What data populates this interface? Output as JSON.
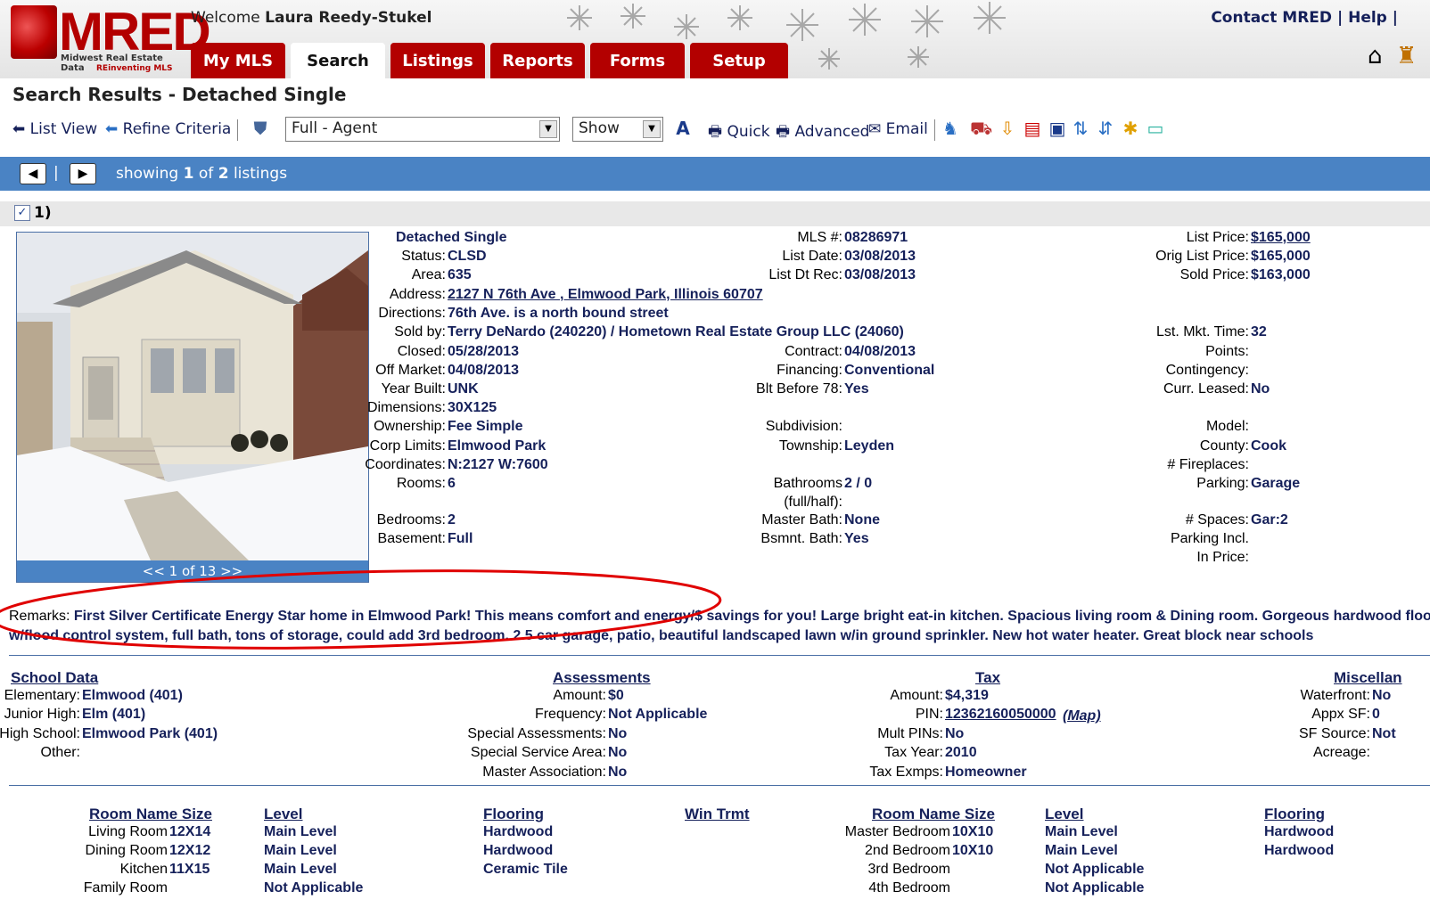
{
  "header": {
    "logo_text": "MRED",
    "logo_sub1": "Midwest Real Estate Data",
    "logo_sub2": "REinventing MLS",
    "welcome_prefix": "Welcome",
    "user_name": "Laura Reedy-Stukel",
    "contact_link": "Contact MRED",
    "help_link": "Help",
    "tabs": [
      "My MLS",
      "Search",
      "Listings",
      "Reports",
      "Forms",
      "Setup"
    ]
  },
  "page_title": "Search Results - Detached Single",
  "toolbar": {
    "list_view": "List View",
    "refine": "Refine Criteria",
    "report_format": "Full - Agent",
    "show": "Show",
    "quick": "Quick",
    "advanced": "Advanced",
    "email": "Email"
  },
  "nav": {
    "showing_prefix": "showing",
    "current": "1",
    "of": "of",
    "total": "2",
    "suffix": "listings"
  },
  "listing": {
    "number": "1)",
    "photo_pager": "<< 1 of 13 >>",
    "property_type": "Detached Single",
    "col1": [
      {
        "label": "Status:",
        "value": "CLSD"
      },
      {
        "label": "Area:",
        "value": "635"
      },
      {
        "label": "Address:",
        "value": "2127 N 76th Ave , Elmwood Park, Illinois 60707"
      },
      {
        "label": "Directions:",
        "value": "76th Ave. is a north bound street"
      },
      {
        "label": "Sold by:",
        "value": "Terry DeNardo (240220) / Hometown Real Estate Group LLC (24060)"
      },
      {
        "label": "Closed:",
        "value": "05/28/2013"
      },
      {
        "label": "Off Market:",
        "value": "04/08/2013"
      },
      {
        "label": "Year Built:",
        "value": "UNK"
      },
      {
        "label": "Dimensions:",
        "value": "30X125"
      },
      {
        "label": "Ownership:",
        "value": "Fee Simple"
      },
      {
        "label": "Corp Limits:",
        "value": "Elmwood Park"
      },
      {
        "label": "Coordinates:",
        "value": "N:2127 W:7600"
      },
      {
        "label": "Rooms:",
        "value": "6"
      },
      {
        "label": "Bedrooms:",
        "value": "2"
      },
      {
        "label": "Basement:",
        "value": "Full"
      }
    ],
    "col2": [
      {
        "label": "MLS #:",
        "value": "08286971"
      },
      {
        "label": "List Date:",
        "value": "03/08/2013"
      },
      {
        "label": "List Dt Rec:",
        "value": "03/08/2013"
      },
      {
        "label": "Contract:",
        "value": "04/08/2013"
      },
      {
        "label": "Financing:",
        "value": "Conventional"
      },
      {
        "label": "Blt Before 78:",
        "value": "Yes"
      },
      {
        "label": "Subdivision:",
        "value": ""
      },
      {
        "label": "Township:",
        "value": "Leyden"
      },
      {
        "label": "Bathrooms",
        "value": "2 / 0"
      },
      {
        "label": "(full/half):",
        "value": ""
      },
      {
        "label": "Master Bath:",
        "value": "None"
      },
      {
        "label": "Bsmnt. Bath:",
        "value": "Yes"
      }
    ],
    "col3": [
      {
        "label": "List Price:",
        "value": "$165,000"
      },
      {
        "label": "Orig List Price:",
        "value": "$165,000"
      },
      {
        "label": "Sold Price:",
        "value": "$163,000"
      },
      {
        "label": "Lst. Mkt. Time:",
        "value": "32"
      },
      {
        "label": "Points:",
        "value": ""
      },
      {
        "label": "Contingency:",
        "value": ""
      },
      {
        "label": "Curr. Leased:",
        "value": "No"
      },
      {
        "label": "Model:",
        "value": ""
      },
      {
        "label": "County:",
        "value": "Cook"
      },
      {
        "label": "# Fireplaces:",
        "value": ""
      },
      {
        "label": "Parking:",
        "value": "Garage"
      },
      {
        "label": "# Spaces:",
        "value": "Gar:2"
      },
      {
        "label": "Parking Incl.",
        "value": ""
      },
      {
        "label": "In Price:",
        "value": ""
      }
    ],
    "remarks_label": "Remarks:",
    "remarks_line1": "First Silver Certificate Energy Star home in Elmwood Park! This means comfort and energy/$ savings for you! Large bright eat-in kitchen. Spacious living room & Dining room. Gorgeous hardwood floors. F",
    "remarks_line2": "w/flood control system, full bath, tons of storage, could add 3rd bedroom. 2.5 car garage, patio, beautiful landscaped lawn w/in ground sprinkler. New hot water heater. Great block near schools"
  },
  "school": {
    "title": "School Data",
    "rows": [
      {
        "label": "Elementary:",
        "value": "Elmwood (401)"
      },
      {
        "label": "Junior High:",
        "value": "Elm (401)"
      },
      {
        "label": "High School:",
        "value": "Elmwood Park (401)"
      },
      {
        "label": "Other:",
        "value": ""
      }
    ]
  },
  "assessments": {
    "title": "Assessments",
    "rows": [
      {
        "label": "Amount:",
        "value": "$0"
      },
      {
        "label": "Frequency:",
        "value": "Not Applicable"
      },
      {
        "label": "Special Assessments:",
        "value": "No"
      },
      {
        "label": "Special Service Area:",
        "value": "No"
      },
      {
        "label": "Master Association:",
        "value": "No"
      }
    ]
  },
  "tax": {
    "title": "Tax",
    "rows": [
      {
        "label": "Amount:",
        "value": "$4,319"
      },
      {
        "label": "PIN:",
        "value": "12362160050000"
      },
      {
        "label": "Mult PINs:",
        "value": "No"
      },
      {
        "label": "Tax Year:",
        "value": "2010"
      },
      {
        "label": "Tax Exmps:",
        "value": "Homeowner"
      }
    ],
    "map_link": "(Map)"
  },
  "misc": {
    "title": "Miscellan",
    "rows": [
      {
        "label": "Waterfront:",
        "value": "No"
      },
      {
        "label": "Appx SF:",
        "value": "0"
      },
      {
        "label": "SF Source:",
        "value": "Not"
      },
      {
        "label": "Acreage:",
        "value": ""
      }
    ]
  },
  "rooms": {
    "headers_left": [
      "Room Name Size",
      "Level",
      "Flooring",
      "Win Trmt"
    ],
    "headers_right": [
      "Room Name Size",
      "Level",
      "Flooring"
    ],
    "left": [
      {
        "name": "Living Room",
        "size": "12X14",
        "level": "Main Level",
        "flooring": "Hardwood"
      },
      {
        "name": "Dining Room",
        "size": "12X12",
        "level": "Main Level",
        "flooring": "Hardwood"
      },
      {
        "name": "Kitchen",
        "size": "11X15",
        "level": "Main Level",
        "flooring": "Ceramic Tile"
      },
      {
        "name": "Family Room",
        "size": "",
        "level": "Not Applicable",
        "flooring": ""
      }
    ],
    "right": [
      {
        "name": "Master Bedroom",
        "size": "10X10",
        "level": "Main Level",
        "flooring": "Hardwood"
      },
      {
        "name": "2nd Bedroom",
        "size": "10X10",
        "level": "Main Level",
        "flooring": "Hardwood"
      },
      {
        "name": "3rd Bedroom",
        "size": "",
        "level": "Not Applicable",
        "flooring": ""
      },
      {
        "name": "4th Bedroom",
        "size": "",
        "level": "Not Applicable",
        "flooring": ""
      }
    ]
  },
  "colors": {
    "brand_red": "#b30000",
    "nav_blue": "#4a83c4",
    "value_navy": "#15205a",
    "annotation_red": "#e00000"
  }
}
